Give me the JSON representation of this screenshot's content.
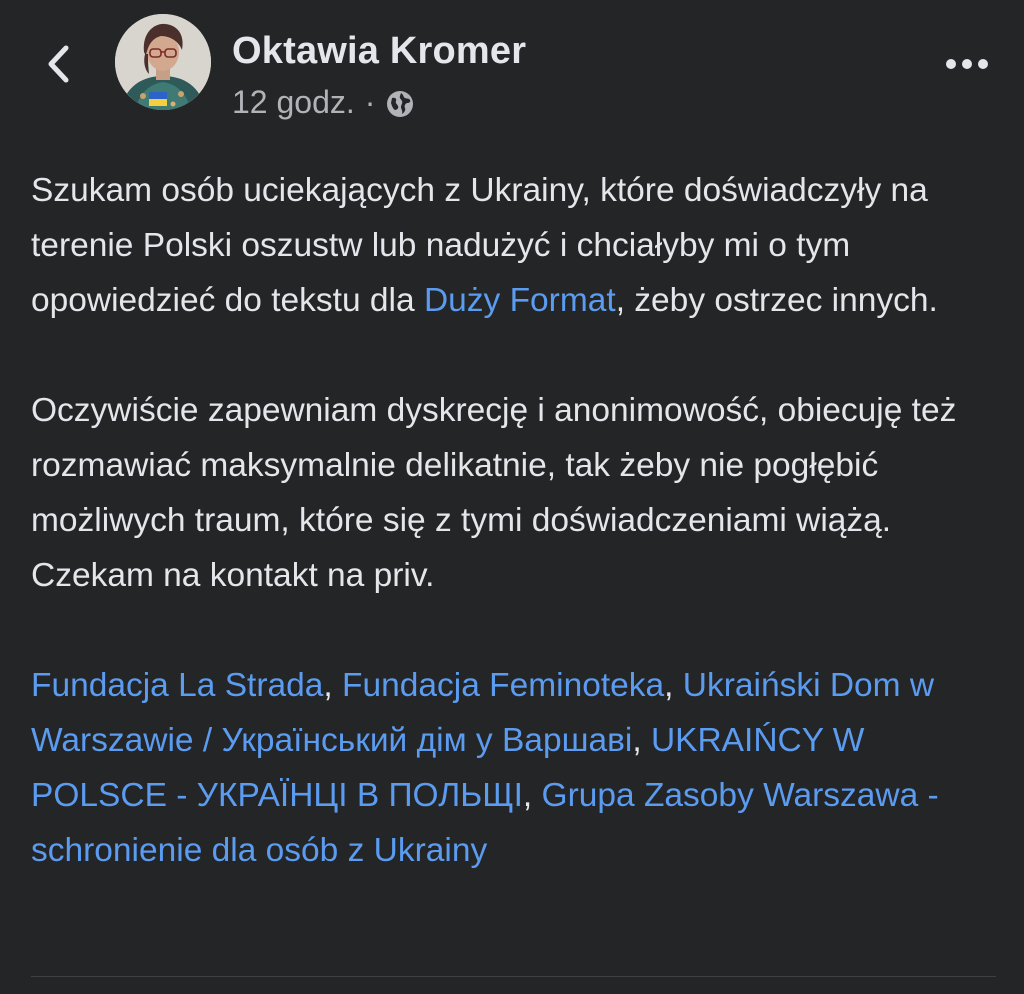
{
  "header": {
    "author_name": "Oktawia Kromer",
    "timestamp": "12 godz.",
    "separator": "·",
    "back_icon": "chevron-left-icon",
    "privacy_icon": "globe-icon",
    "more_icon": "more-horizontal-icon"
  },
  "post": {
    "p1": {
      "t1": "Szukam osób uciekających z Ukrainy, które doświadczyły na terenie Polski oszustw lub nadużyć i chciałyby mi o tym opowiedzieć do tekstu dla ",
      "link": "Duży Format",
      "t2": ", żeby ostrzec innych."
    },
    "p2": "Oczywiście zapewniam dyskrecję i anonimowość, obiecuję też rozmawiać maksymalnie delikatnie, tak żeby nie pogłębić możliwych traum, które się z tymi doświadczeniami wiążą. Czekam na kontakt na priv.",
    "tags": [
      "Fundacja La Strada",
      "Fundacja Feminoteka",
      "Ukraiński Dom w Warszawie / Український дім у Варшаві",
      "UKRAIŃCY W POLSCE - УКРАЇНЦІ В ПОЛЬЩІ",
      "Grupa Zasoby Warszawa - schronienie dla osób z Ukrainy"
    ],
    "tag_separator": ","
  },
  "colors": {
    "background": "#242526",
    "text": "#e4e6eb",
    "secondary_text": "#b0b3b8",
    "link": "#5b9bf0"
  }
}
